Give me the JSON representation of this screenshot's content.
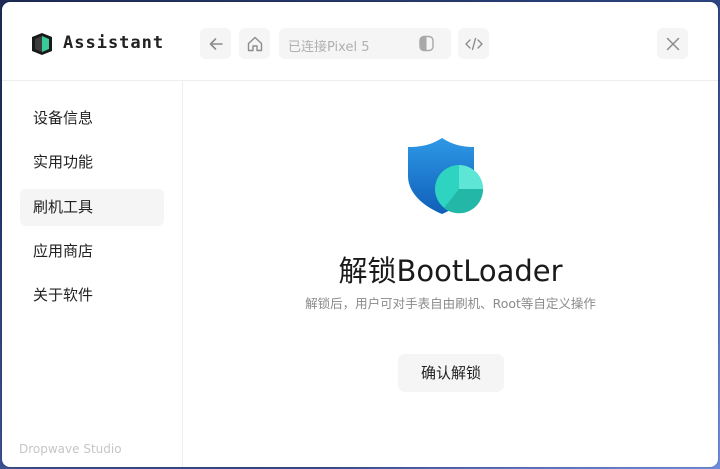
{
  "app": {
    "title": "Assistant"
  },
  "titlebar": {
    "back_icon": "arrow-left-icon",
    "home_icon": "home-icon",
    "device_label": "已连接Pixel 5",
    "device_icon": "phone-half-icon",
    "code_icon": "code-icon",
    "close_icon": "close-icon"
  },
  "sidebar": {
    "items": [
      {
        "label": "设备信息"
      },
      {
        "label": "实用功能"
      },
      {
        "label": "刷机工具",
        "active": true
      },
      {
        "label": "应用商店"
      },
      {
        "label": "关于软件"
      }
    ],
    "footer": "Dropwave Studio"
  },
  "main": {
    "icon": "shield-pie-icon",
    "title": "解锁BootLoader",
    "subtitle": "解锁后，用户可对手表自由刷机、Root等自定义操作",
    "confirm_label": "确认解锁"
  },
  "colors": {
    "accent_blue": "#1a7fd4",
    "accent_teal": "#2fd3c1",
    "panel": "#f5f5f5"
  }
}
